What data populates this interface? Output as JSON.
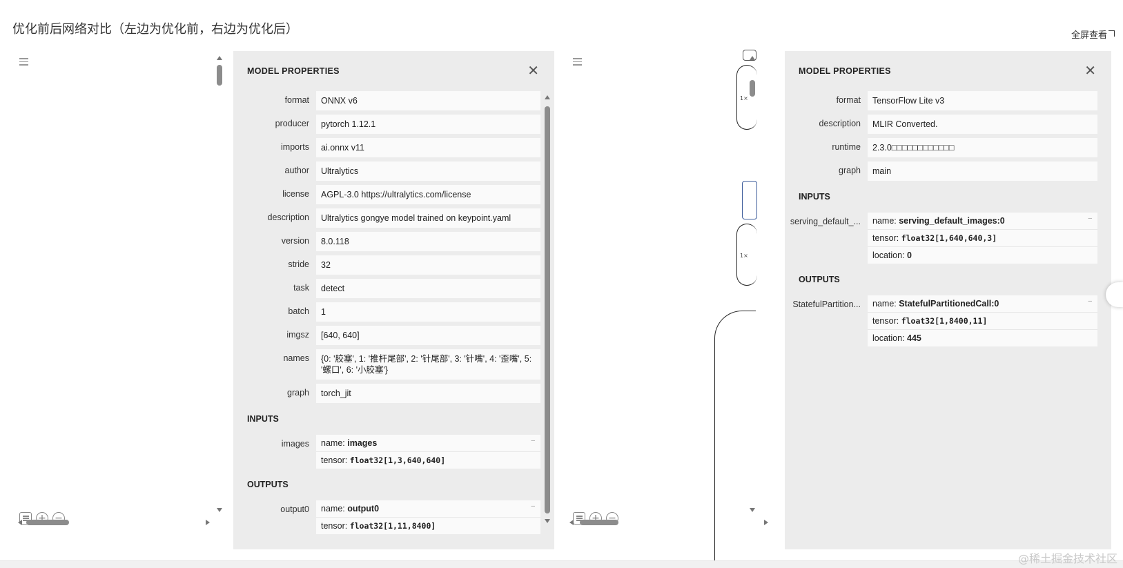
{
  "page": {
    "title": "优化前后网络对比（左边为优化前，右边为优化后）",
    "fullscreen_label": "全屏查看",
    "watermark": "@稀土掘金技术社区"
  },
  "left": {
    "panel_title": "MODEL PROPERTIES",
    "properties": [
      {
        "label": "format",
        "value": "ONNX v6"
      },
      {
        "label": "producer",
        "value": "pytorch 1.12.1"
      },
      {
        "label": "imports",
        "value": "ai.onnx v11"
      },
      {
        "label": "author",
        "value": "Ultralytics"
      },
      {
        "label": "license",
        "value": "AGPL-3.0 https://ultralytics.com/license"
      },
      {
        "label": "description",
        "value": "Ultralytics gongye model trained on keypoint.yaml"
      },
      {
        "label": "version",
        "value": "8.0.118"
      },
      {
        "label": "stride",
        "value": "32"
      },
      {
        "label": "task",
        "value": "detect"
      },
      {
        "label": "batch",
        "value": "1"
      },
      {
        "label": "imgsz",
        "value": "[640, 640]"
      },
      {
        "label": "names",
        "value": "{0: '胶塞', 1: '推杆尾部', 2: '针尾部', 3: '针嘴', 4: '歪嘴', 5: '螺口', 6: '小胶塞'}"
      },
      {
        "label": "graph",
        "value": "torch_jit"
      }
    ],
    "inputs_title": "INPUTS",
    "inputs": [
      {
        "label": "images",
        "name_key": "name: ",
        "name": "images",
        "tensor_key": "tensor: ",
        "tensor": "float32[1,3,640,640]"
      }
    ],
    "outputs_title": "OUTPUTS",
    "outputs": [
      {
        "label": "output0",
        "name_key": "name: ",
        "name": "output0",
        "tensor_key": "tensor: ",
        "tensor": "float32[1,11,8400]"
      }
    ]
  },
  "right": {
    "panel_title": "MODEL PROPERTIES",
    "properties": [
      {
        "label": "format",
        "value": "TensorFlow Lite v3"
      },
      {
        "label": "description",
        "value": "MLIR Converted."
      },
      {
        "label": "runtime",
        "value": "2.3.0□□□□□□□□□□□□"
      },
      {
        "label": "graph",
        "value": "main"
      }
    ],
    "inputs_title": "INPUTS",
    "inputs": [
      {
        "label": "serving_default_...",
        "name_key": "name: ",
        "name": "serving_default_images:0",
        "tensor_key": "tensor: ",
        "tensor": "float32[1,640,640,3]",
        "location_key": "location: ",
        "location": "0"
      }
    ],
    "outputs_title": "OUTPUTS",
    "outputs": [
      {
        "label": "StatefulPartition...",
        "name_key": "name: ",
        "name": "StatefulPartitionedCall:0",
        "tensor_key": "tensor: ",
        "tensor": "float32[1,8400,11]",
        "location_key": "location: ",
        "location": "445"
      }
    ],
    "graph_labels": [
      "1×",
      "1×"
    ]
  },
  "icons": {
    "menu": "hamburger-icon",
    "close": "close-icon",
    "zoom_in": "zoom-in-icon",
    "zoom_out": "zoom-out-icon",
    "list": "list-icon",
    "fullscreen": "expand-icon"
  }
}
